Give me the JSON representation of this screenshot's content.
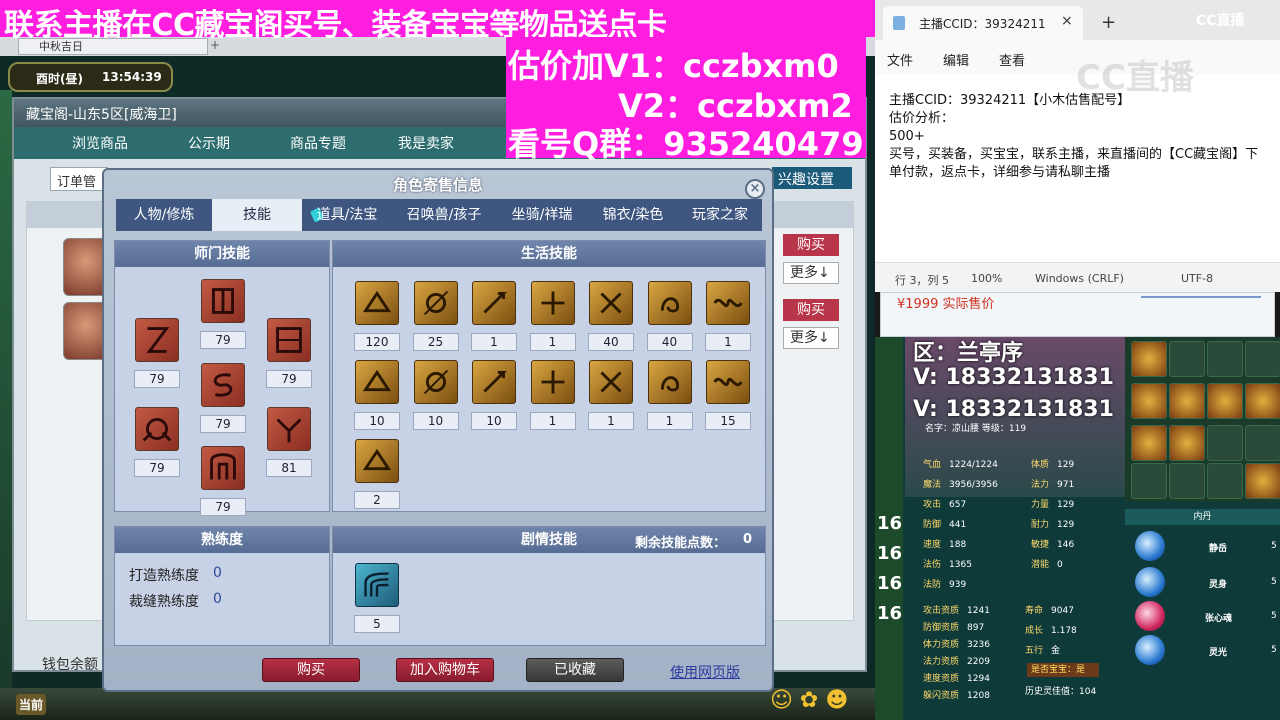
{
  "game": {
    "tab_title": "中秋吉日",
    "clock_day": "酉时(昼)",
    "clock_time": "13:54:39",
    "current_label": "当前"
  },
  "banner": {
    "top_text": "联系主播在CC藏宝阁买号、装备宝宝等物品送点卡",
    "line1": "估价加V1：cczbxm0",
    "line2": "V2：cczbxm2",
    "line3": "看号Q群：935240479"
  },
  "cbg": {
    "title": "藏宝阁-山东5区[威海卫]",
    "nav": [
      "浏览商品",
      "公示期",
      "商品专题",
      "我是卖家"
    ],
    "order_manage": "订单管",
    "interest_setting": "兴趣设置",
    "buy_label": "购买",
    "more_label": "更多↓",
    "wallet_label": "钱包余额"
  },
  "dialog": {
    "title": "角色寄售信息",
    "close": "×",
    "tabs": [
      "人物/修炼",
      "技能",
      "道具/法宝",
      "召唤兽/孩子",
      "坐骑/祥瑞",
      "锦衣/染色",
      "玩家之家"
    ],
    "active_tab": 1,
    "school_skills_title": "师门技能",
    "school_skills": [
      "79",
      "79",
      "79",
      "79",
      "79",
      "81",
      "79"
    ],
    "life_skills_title": "生活技能",
    "life_skills": [
      "120",
      "25",
      "1",
      "1",
      "40",
      "40",
      "1",
      "10",
      "10",
      "10",
      "1",
      "1",
      "1",
      "15",
      "2"
    ],
    "proficiency_title": "熟练度",
    "proficiency": [
      {
        "label": "打造熟练度",
        "value": "0"
      },
      {
        "label": "裁缝熟练度",
        "value": "0"
      }
    ],
    "story_skills_title": "剧情技能",
    "remaining_points_label": "剩余技能点数：",
    "remaining_points": "0",
    "story_skills": [
      "5"
    ],
    "buttons": {
      "buy": "购买",
      "add_cart": "加入购物车",
      "collected": "已收藏",
      "web_version": "使用网页版"
    }
  },
  "notepad": {
    "tab_title": "主播CCID：39324211",
    "close": "×",
    "new_tab": "+",
    "menu": [
      "文件",
      "编辑",
      "查看"
    ],
    "lines": [
      "主播CCID：39324211【小木估售配号】",
      "估价分析：",
      "500+",
      "买号，买装备，买宝宝，联系主播，来直播间的【CC藏宝阁】下单付款，返点卡，详细参与请私聊主播"
    ],
    "status": {
      "position": "行 3，列 5",
      "zoom": "100%",
      "eol": "Windows (CRLF)",
      "encoding": "UTF-8"
    },
    "watermark": "CC直播",
    "brand": "CC直播"
  },
  "shop_strip": {
    "price": "¥1999 实际售价"
  },
  "status_panel": {
    "overlay_region": "区：兰亭序",
    "overlay_v1": "V: 18332131831",
    "overlay_v2": "V: 18332131831",
    "name_label": "名字：凉山腰  等级：119",
    "side_numbers": [
      "16",
      "16",
      "16",
      "16"
    ],
    "attrs": [
      {
        "k": "气血",
        "v": "1224/1224"
      },
      {
        "k": "魔法",
        "v": "3956/3956"
      },
      {
        "k": "攻击",
        "v": "657"
      },
      {
        "k": "防御",
        "v": "441"
      },
      {
        "k": "速度",
        "v": "188"
      },
      {
        "k": "法伤",
        "v": "1365"
      },
      {
        "k": "法防",
        "v": "939"
      }
    ],
    "attrs2": [
      {
        "k": "体质",
        "v": "129"
      },
      {
        "k": "法力",
        "v": "971"
      },
      {
        "k": "力量",
        "v": "129"
      },
      {
        "k": "耐力",
        "v": "129"
      },
      {
        "k": "敏捷",
        "v": "146"
      },
      {
        "k": "潜能",
        "v": "0"
      }
    ],
    "attrs3": [
      {
        "k": "攻击资质",
        "v": "1241"
      },
      {
        "k": "防御资质",
        "v": "897"
      },
      {
        "k": "体力资质",
        "v": "3236"
      },
      {
        "k": "法力资质",
        "v": "2209"
      },
      {
        "k": "速度资质",
        "v": "1294"
      },
      {
        "k": "躲闪资质",
        "v": "1208"
      }
    ],
    "attrs4": [
      {
        "k": "寿命",
        "v": "9047"
      },
      {
        "k": "成长",
        "v": "1.178"
      },
      {
        "k": "五行",
        "v": "金"
      }
    ],
    "treasure_label": "是否宝宝：是",
    "history_label": "历史灵佳值：104",
    "neidan_title": "内丹",
    "neidan": [
      {
        "name": "静岳",
        "v": "5"
      },
      {
        "name": "灵身",
        "v": "5"
      },
      {
        "name": "张心魂",
        "v": "5"
      },
      {
        "name": "灵光",
        "v": "5"
      }
    ]
  }
}
